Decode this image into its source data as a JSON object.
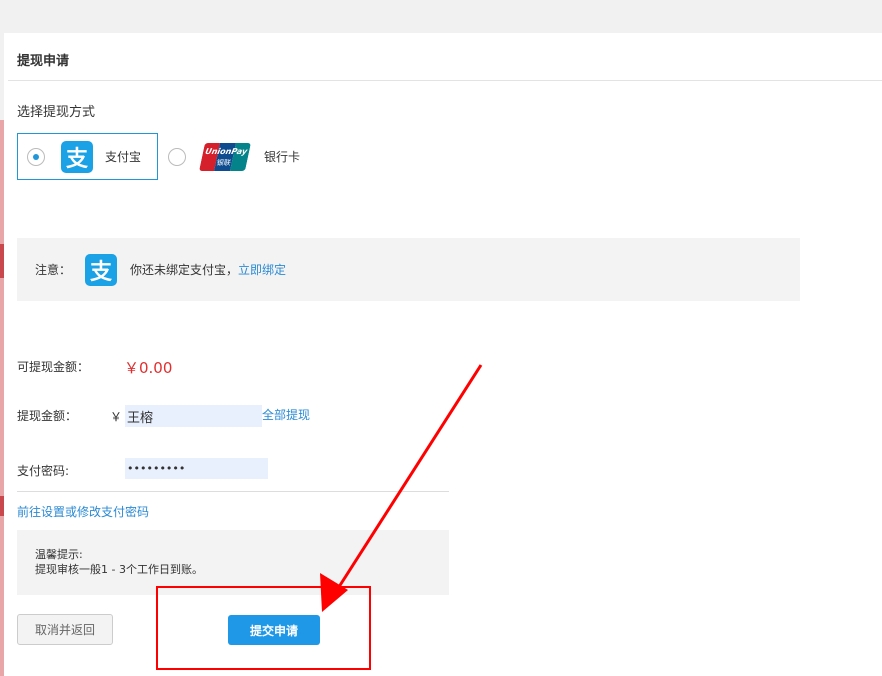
{
  "header": {
    "title": "提现申请"
  },
  "method": {
    "section_label": "选择提现方式",
    "options": [
      {
        "label": "支付宝",
        "icon": "alipay-logo",
        "logo_glyph": "支",
        "selected": true
      },
      {
        "label": "银行卡",
        "icon": "unionpay-logo",
        "logo_text": "UnionPay",
        "logo_sub": "银联",
        "selected": false
      }
    ]
  },
  "notice": {
    "label": "注意：",
    "text": "你还未绑定支付宝，",
    "link": "立即绑定",
    "logo_glyph": "支"
  },
  "form": {
    "available_label": "可提现金额：",
    "available_value": "￥0.00",
    "amount_label": "提现金额：",
    "currency_symbol": "￥",
    "amount_value": "王榕",
    "withdraw_all_link": "全部提现",
    "password_label": "支付密码:",
    "password_value": "•••••••••",
    "set_password_link": "前往设置或修改支付密码"
  },
  "tips": {
    "title": "温馨提示:",
    "text": "提现审核一般1 - 3个工作日到账。"
  },
  "buttons": {
    "cancel_label": "取消并返回",
    "submit_label": "提交申请"
  },
  "colors": {
    "accent": "#1f98e8",
    "amount_red": "#e02f2f",
    "annotation_red": "#ff0000"
  }
}
